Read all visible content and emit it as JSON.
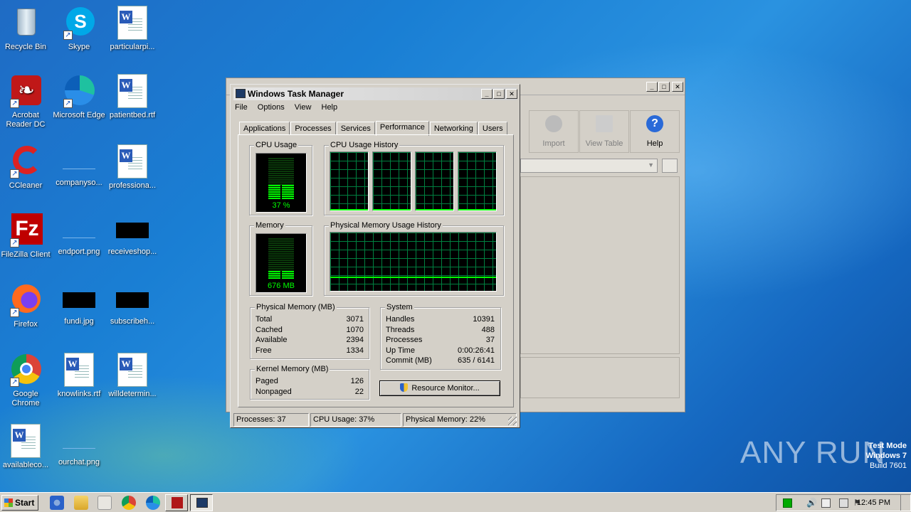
{
  "desktop": {
    "icons": [
      {
        "label": "Recycle Bin",
        "icon": "recycle-bin-icon"
      },
      {
        "label": "Skype",
        "icon": "skype-icon"
      },
      {
        "label": "particularpi...",
        "icon": "word-document-icon"
      },
      {
        "label": "Acrobat Reader DC",
        "icon": "acrobat-icon"
      },
      {
        "label": "Microsoft Edge",
        "icon": "edge-icon"
      },
      {
        "label": "patientbed.rtf",
        "icon": "word-document-icon"
      },
      {
        "label": "CCleaner",
        "icon": "ccleaner-icon"
      },
      {
        "label": "companyso...",
        "icon": "image-file-icon"
      },
      {
        "label": "professiona...",
        "icon": "word-document-icon"
      },
      {
        "label": "FileZilla Client",
        "icon": "filezilla-icon"
      },
      {
        "label": "endport.png",
        "icon": "image-file-icon"
      },
      {
        "label": "receiveshop...",
        "icon": "image-file-icon"
      },
      {
        "label": "Firefox",
        "icon": "firefox-icon"
      },
      {
        "label": "fundi.jpg",
        "icon": "image-file-icon"
      },
      {
        "label": "subscribeh...",
        "icon": "image-file-icon"
      },
      {
        "label": "Google Chrome",
        "icon": "chrome-icon"
      },
      {
        "label": "knowlinks.rtf",
        "icon": "word-document-icon"
      },
      {
        "label": "willdetermin...",
        "icon": "word-document-icon"
      },
      {
        "label": "availableco...",
        "icon": "word-document-icon"
      },
      {
        "label": "ourchat.png",
        "icon": "image-file-icon"
      }
    ]
  },
  "background_window": {
    "toolbar": {
      "import_label": "Import",
      "view_table_label": "View Table",
      "help_label": "Help"
    }
  },
  "task_manager": {
    "title": "Windows Task Manager",
    "menu": [
      "File",
      "Options",
      "View",
      "Help"
    ],
    "tabs": [
      "Applications",
      "Processes",
      "Services",
      "Performance",
      "Networking",
      "Users"
    ],
    "active_tab": "Performance",
    "cpu_usage": {
      "caption": "CPU Usage",
      "value_text": "37 %",
      "percent": 37
    },
    "cpu_history": {
      "caption": "CPU Usage History",
      "cores": 4
    },
    "memory": {
      "caption": "Memory",
      "value_text": "676 MB",
      "percent": 22
    },
    "memory_history": {
      "caption": "Physical Memory Usage History"
    },
    "physical_memory": {
      "caption": "Physical Memory (MB)",
      "rows": [
        {
          "label": "Total",
          "value": "3071"
        },
        {
          "label": "Cached",
          "value": "1070"
        },
        {
          "label": "Available",
          "value": "2394"
        },
        {
          "label": "Free",
          "value": "1334"
        }
      ]
    },
    "kernel_memory": {
      "caption": "Kernel Memory (MB)",
      "rows": [
        {
          "label": "Paged",
          "value": "126"
        },
        {
          "label": "Nonpaged",
          "value": "22"
        }
      ]
    },
    "system": {
      "caption": "System",
      "rows": [
        {
          "label": "Handles",
          "value": "10391"
        },
        {
          "label": "Threads",
          "value": "488"
        },
        {
          "label": "Processes",
          "value": "37"
        },
        {
          "label": "Up Time",
          "value": "0:00:26:41"
        },
        {
          "label": "Commit (MB)",
          "value": "635 / 6141"
        }
      ]
    },
    "resource_monitor_label": "Resource Monitor...",
    "status": {
      "processes": "Processes: 37",
      "cpu": "CPU Usage: 37%",
      "memory": "Physical Memory: 22%"
    }
  },
  "taskbar": {
    "start_label": "Start",
    "clock": "12:45 PM"
  },
  "watermark": {
    "brand": "ANY RUN",
    "line1": "Test Mode",
    "line2": "Windows 7",
    "line3": "Build 7601"
  }
}
